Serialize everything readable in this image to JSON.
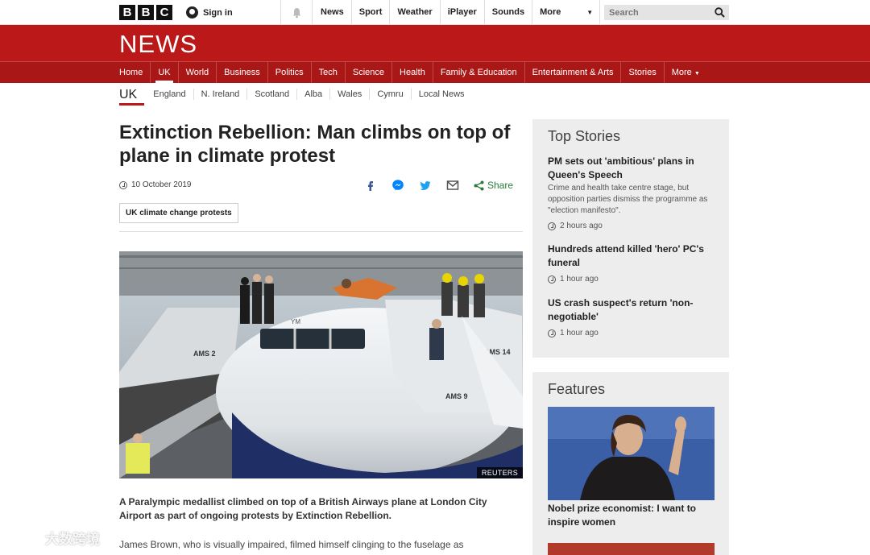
{
  "topbar": {
    "logo_letters": [
      "B",
      "B",
      "C"
    ],
    "signin_label": "Sign in",
    "nav": [
      "News",
      "Sport",
      "Weather",
      "iPlayer",
      "Sounds",
      "More"
    ],
    "search_placeholder": "Search"
  },
  "masthead": {
    "brand": "NEWS",
    "brand_color": "#bb1919"
  },
  "main_nav": {
    "items": [
      "Home",
      "UK",
      "World",
      "Business",
      "Politics",
      "Tech",
      "Science",
      "Health",
      "Family & Education",
      "Entertainment & Arts",
      "Stories",
      "More"
    ],
    "active": "UK"
  },
  "sub_nav": {
    "current": "UK",
    "items": [
      "England",
      "N. Ireland",
      "Scotland",
      "Alba",
      "Wales",
      "Cymru",
      "Local News"
    ]
  },
  "article": {
    "headline": "Extinction Rebellion: Man climbs on top of plane in climate protest",
    "date": "10 October 2019",
    "share_label": "Share",
    "tag": "UK climate change protests",
    "image_credit": "REUTERS",
    "intro": "A Paralympic medallist climbed on top of a British Airways plane at London City Airport as part of ongoing protests by Extinction Rebellion.",
    "body": "James Brown, who is visually impaired, filmed himself clinging to the fuselage as"
  },
  "top_stories": {
    "title": "Top Stories",
    "items": [
      {
        "title": "PM sets out 'ambitious' plans in Queen's Speech",
        "summary": "Crime and health take centre stage, but opposition parties dismiss the programme as \"election manifesto\".",
        "time": "2 hours ago"
      },
      {
        "title": "Hundreds attend killed 'hero' PC's funeral",
        "summary": "",
        "time": "1 hour ago"
      },
      {
        "title": "US crash suspect's return 'non-negotiable'",
        "summary": "",
        "time": "1 hour ago"
      }
    ]
  },
  "features": {
    "title": "Features",
    "items": [
      {
        "title": "Nobel prize economist: I want to inspire women"
      }
    ]
  },
  "watermark": {
    "text": "大数跨境"
  }
}
